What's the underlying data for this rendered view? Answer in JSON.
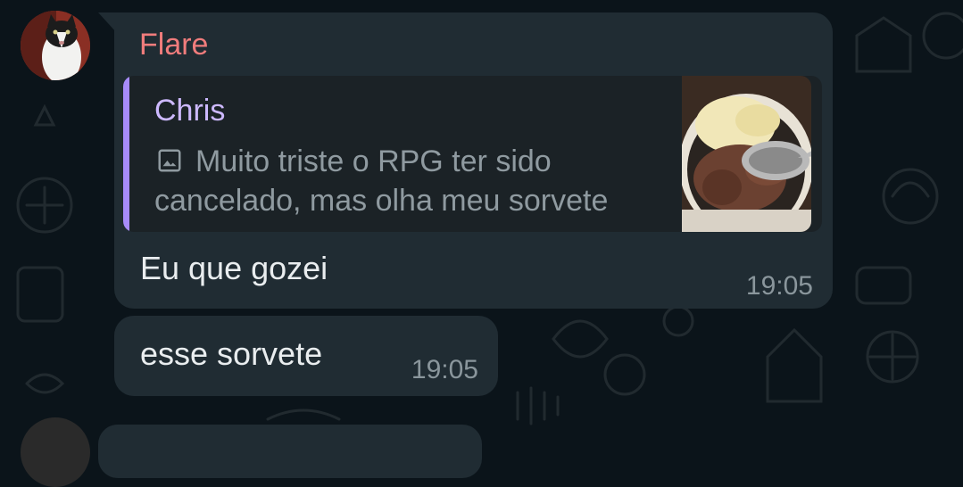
{
  "chat": {
    "messages": [
      {
        "sender": "Flare",
        "reply": {
          "author": "Chris",
          "media_icon": "image-icon",
          "text": "Muito triste o RPG ter sido cancelado, mas olha meu sorvete"
        },
        "text": "Eu que gozei",
        "time": "19:05"
      },
      {
        "text": "esse sorvete",
        "time": "19:05"
      }
    ]
  },
  "colors": {
    "background": "#0b141a",
    "bubble": "#202c33",
    "sender_name": "#f07c7c",
    "quote_bar": "#a78bfa",
    "quote_author": "#cdb9ff"
  }
}
